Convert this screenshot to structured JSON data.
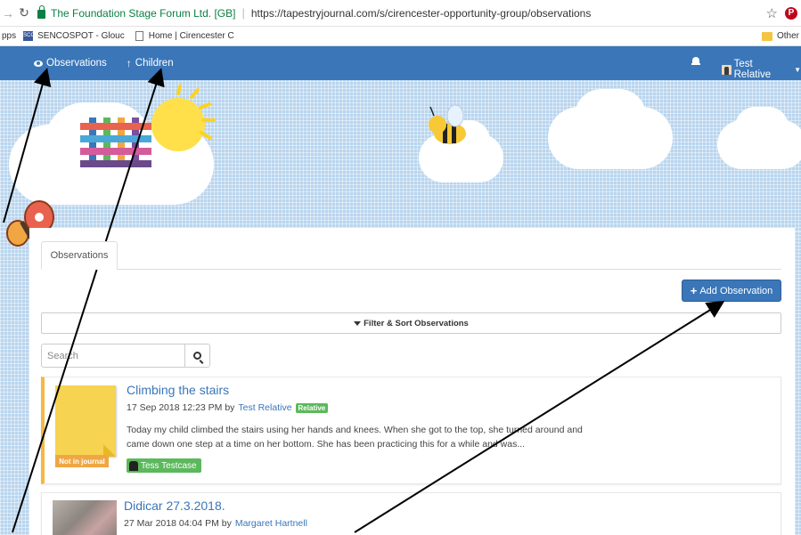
{
  "browser": {
    "site_identity": "The Foundation Stage Forum Ltd. [GB]",
    "url": "https://tapestryjournal.com/s/cirencester-opportunity-group/observations",
    "bookmarks": [
      {
        "label": "pps",
        "icon": "apps-icon"
      },
      {
        "label": "SENCOSPOT - Glouc",
        "icon": "scc-icon"
      },
      {
        "label": "Home | Cirencester C",
        "icon": "document-icon"
      }
    ],
    "other_bookmarks": "Other",
    "scc_icon_text": "SCC"
  },
  "nav": {
    "observations": "Observations",
    "children": "Children",
    "user": "Test Relative"
  },
  "tabs": [
    "Observations"
  ],
  "actions": {
    "add_observation": "Add Observation",
    "filter_sort": "Filter & Sort Observations",
    "search_placeholder": "Search"
  },
  "observations": [
    {
      "title": "Climbing the stairs",
      "date": "17 Sep 2018 12:23 PM by",
      "author": "Test Relative",
      "role_badge": "Relative",
      "body": "Today my child climbed the stairs using her hands and knees. When she got to the top, she turned around and came down one step at a time on her bottom. She has been practicing this for a while and was...",
      "status": "Not in journal",
      "child": "Tess Testcase"
    },
    {
      "title": "Didicar 27.3.2018.",
      "date": "27 Mar 2018 04:04 PM by",
      "author": "Margaret Hartnell"
    }
  ],
  "colors": {
    "nav_blue": "#3a76b8",
    "banner_blue": "#b9d5ee",
    "success_green": "#5cb85c",
    "warning_orange": "#f0a743"
  }
}
